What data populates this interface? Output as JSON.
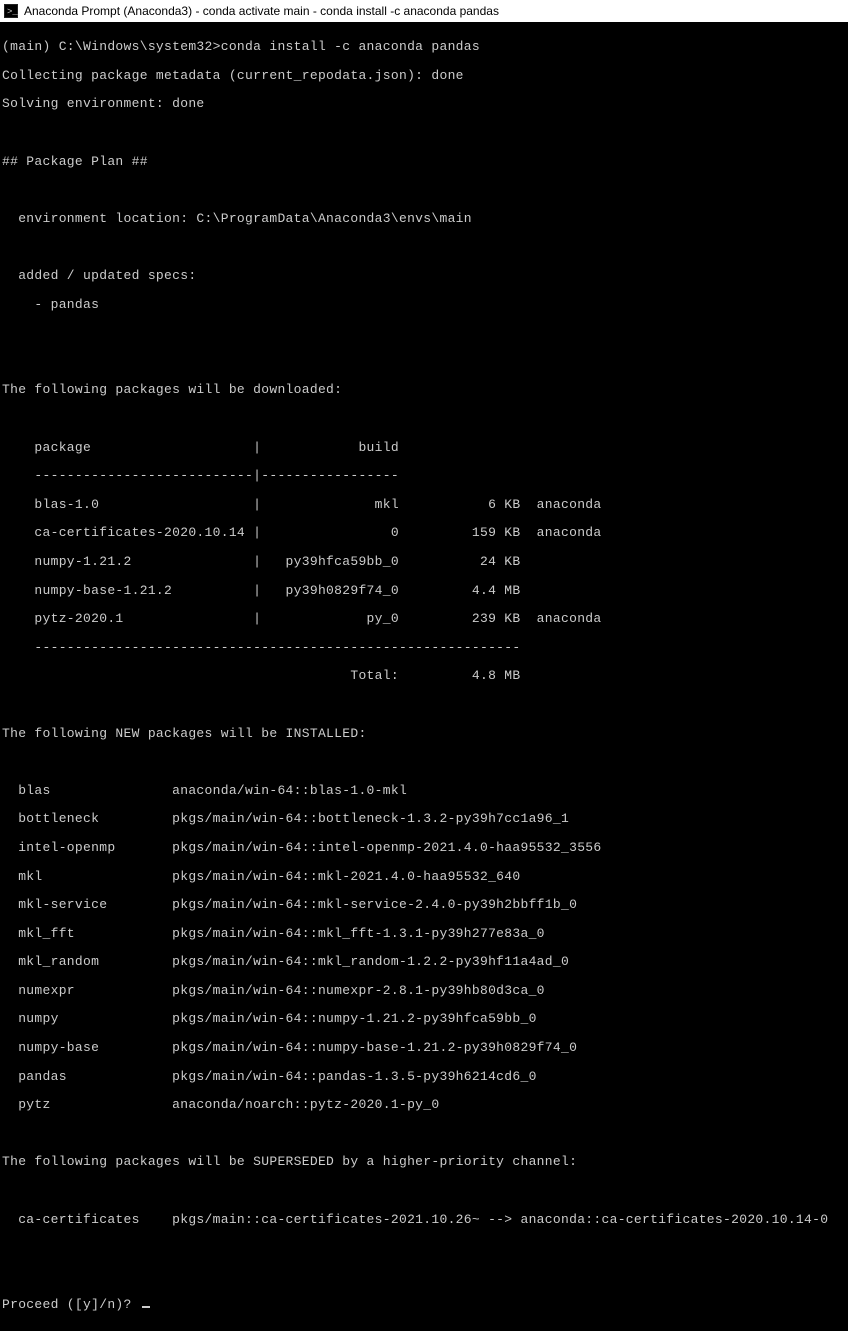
{
  "titlebar": {
    "text": "Anaconda Prompt (Anaconda3) - conda  activate main - conda  install -c anaconda pandas"
  },
  "terminal": {
    "prompt_line": "(main) C:\\Windows\\system32>conda install -c anaconda pandas",
    "collecting": "Collecting package metadata (current_repodata.json): done",
    "solving": "Solving environment: done",
    "plan_header": "## Package Plan ##",
    "env_location": "  environment location: C:\\ProgramData\\Anaconda3\\envs\\main",
    "added_specs_header": "  added / updated specs:",
    "added_specs_item": "    - pandas",
    "downloads_header": "The following packages will be downloaded:",
    "table_header": "    package                    |            build",
    "table_sep": "    ---------------------------|-----------------",
    "row_blas": "    blas-1.0                   |              mkl           6 KB  anaconda",
    "row_ca": "    ca-certificates-2020.10.14 |                0         159 KB  anaconda",
    "row_numpy": "    numpy-1.21.2               |   py39hfca59bb_0          24 KB",
    "row_numpyb": "    numpy-base-1.21.2          |   py39h0829f74_0         4.4 MB",
    "row_pytz": "    pytz-2020.1                |             py_0         239 KB  anaconda",
    "row_btm": "    ------------------------------------------------------------",
    "row_total": "                                           Total:         4.8 MB",
    "installed_header": "The following NEW packages will be INSTALLED:",
    "inst_blas": "  blas               anaconda/win-64::blas-1.0-mkl",
    "inst_bottleneck": "  bottleneck         pkgs/main/win-64::bottleneck-1.3.2-py39h7cc1a96_1",
    "inst_intel": "  intel-openmp       pkgs/main/win-64::intel-openmp-2021.4.0-haa95532_3556",
    "inst_mkl": "  mkl                pkgs/main/win-64::mkl-2021.4.0-haa95532_640",
    "inst_mklsvc": "  mkl-service        pkgs/main/win-64::mkl-service-2.4.0-py39h2bbff1b_0",
    "inst_mklfft": "  mkl_fft            pkgs/main/win-64::mkl_fft-1.3.1-py39h277e83a_0",
    "inst_mklrnd": "  mkl_random         pkgs/main/win-64::mkl_random-1.2.2-py39hf11a4ad_0",
    "inst_numexpr": "  numexpr            pkgs/main/win-64::numexpr-2.8.1-py39hb80d3ca_0",
    "inst_numpy": "  numpy              pkgs/main/win-64::numpy-1.21.2-py39hfca59bb_0",
    "inst_numpyb": "  numpy-base         pkgs/main/win-64::numpy-base-1.21.2-py39h0829f74_0",
    "inst_pandas": "  pandas             pkgs/main/win-64::pandas-1.3.5-py39h6214cd6_0",
    "inst_pytz": "  pytz               anaconda/noarch::pytz-2020.1-py_0",
    "super_header": "The following packages will be SUPERSEDED by a higher-priority channel:",
    "super_ca": "  ca-certificates    pkgs/main::ca-certificates-2021.10.26~ --> anaconda::ca-certificates-2020.10.14-0",
    "proceed": "Proceed ([y]/n)? "
  }
}
